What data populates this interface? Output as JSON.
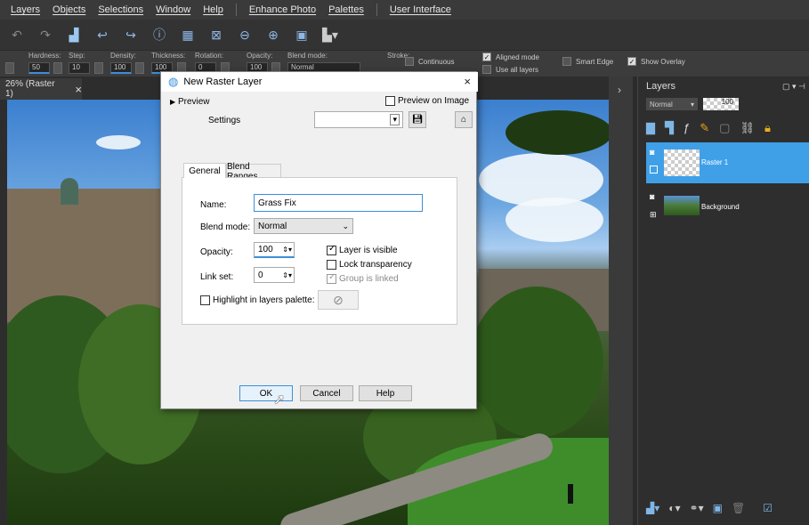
{
  "menu": [
    "Layers",
    "Objects",
    "Selections",
    "Window",
    "Help",
    "Enhance Photo",
    "Palettes",
    "User Interface"
  ],
  "options": {
    "labels": [
      "Hardness:",
      "Step:",
      "Density:",
      "Thickness:",
      "Rotation:",
      "Opacity:",
      "Blend mode:",
      "Stroke:"
    ],
    "values": {
      "hardness": "50",
      "step": "10",
      "density": "100",
      "thickness": "100",
      "rotation": "0",
      "opacity": "100",
      "blend": "Normal"
    },
    "continuous": "Continuous",
    "aligned_mode": "Aligned mode",
    "use_all_layers": "Use all layers",
    "smart_edge": "Smart Edge",
    "show_overlay": "Show Overlay"
  },
  "doc_tab": {
    "label": "26% (Raster 1)",
    "close": "×"
  },
  "layers": {
    "title": "Layers",
    "mode": "Normal",
    "opacity": "100",
    "items": [
      {
        "name": "Raster 1"
      },
      {
        "name": "Background"
      }
    ]
  },
  "dialog": {
    "title": "New Raster Layer",
    "close": "×",
    "preview": "Preview",
    "preview_on_image": "Preview on Image",
    "settings": "Settings",
    "tabs": [
      "General",
      "Blend Ranges"
    ],
    "name_label": "Name:",
    "name_value": "Grass Fix",
    "blend_label": "Blend mode:",
    "blend_value": "Normal",
    "opacity_label": "Opacity:",
    "opacity_value": "100",
    "linkset_label": "Link set:",
    "linkset_value": "0",
    "layer_visible": "Layer is visible",
    "lock_transparency": "Lock transparency",
    "group_linked": "Group is linked",
    "highlight": "Highlight in layers palette:",
    "ok": "OK",
    "cancel": "Cancel",
    "help": "Help"
  },
  "colors": {
    "selected_layer": "#3fa0e8",
    "accent": "#3c8fd8"
  }
}
